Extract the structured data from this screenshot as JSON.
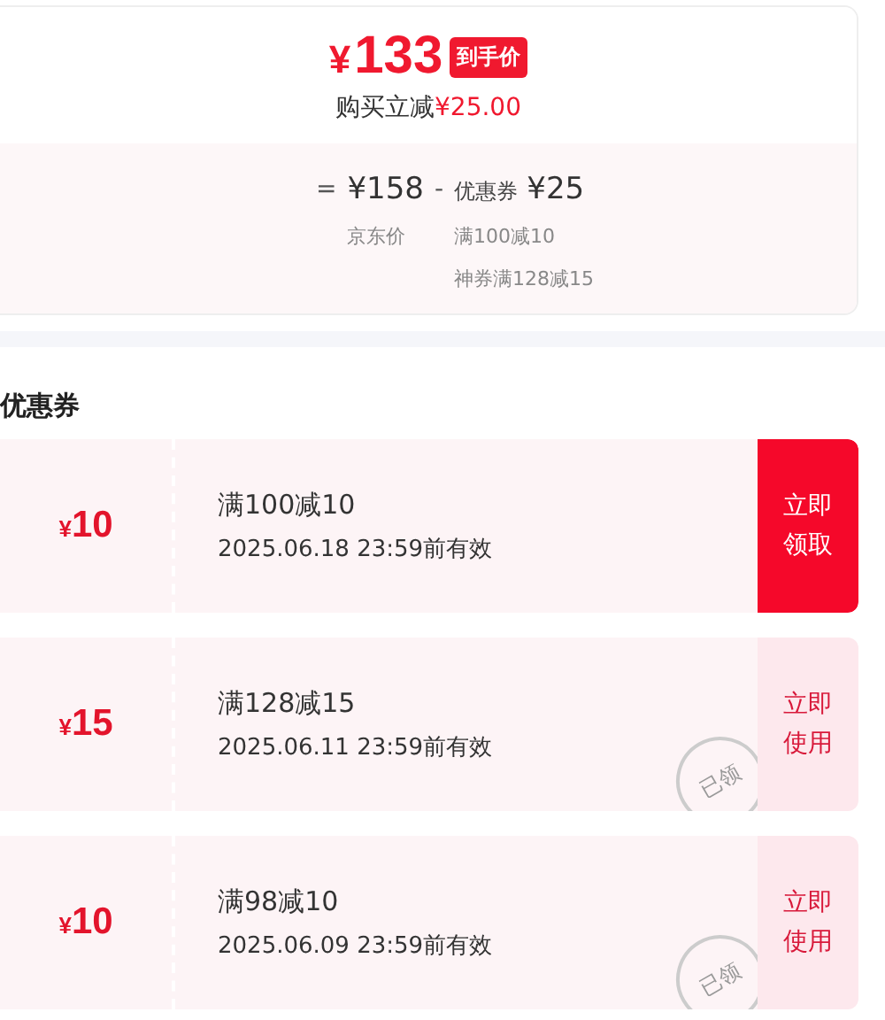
{
  "price": {
    "final": "¥133",
    "badge": "到手价",
    "saving_label": "购买立减",
    "saving_amount": "¥25.00"
  },
  "breakdown": {
    "equals": "=",
    "base_price": "¥158",
    "minus": "-",
    "coupon_label": "优惠券",
    "coupon_amount": "¥25",
    "base_caption": "京东价",
    "coupon_details": [
      "满100减10",
      "神券满128减15"
    ]
  },
  "section_title": "优惠券",
  "coupons": [
    {
      "amount": "¥10",
      "condition": "满100减10",
      "validity": "2025.06.18 23:59前有效",
      "action": "立即领取",
      "claimed": false
    },
    {
      "amount": "¥15",
      "condition": "满128减15",
      "validity": "2025.06.11 23:59前有效",
      "action": "立即使用",
      "claimed": true,
      "stamp": "已领"
    },
    {
      "amount": "¥10",
      "condition": "满98减10",
      "validity": "2025.06.09 23:59前有效",
      "action": "立即使用",
      "claimed": true,
      "stamp": "已领"
    }
  ]
}
